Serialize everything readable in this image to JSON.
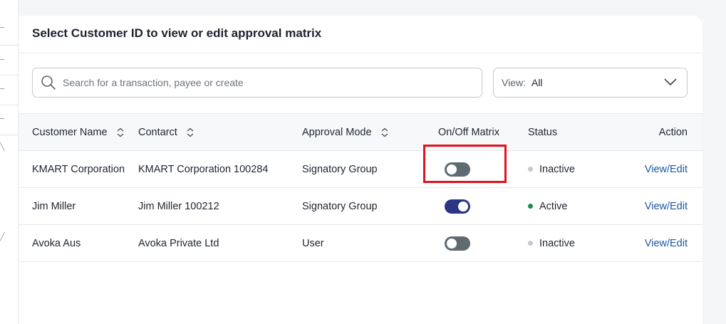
{
  "card": {
    "title": "Select Customer ID to view or edit approval matrix"
  },
  "search": {
    "placeholder": "Search for a transaction, payee or create",
    "icon": "search-icon"
  },
  "view_filter": {
    "label": "View:",
    "value": "All",
    "icon": "chevron-down-icon"
  },
  "table": {
    "headers": {
      "customer_name": "Customer Name",
      "contact": "Contarct",
      "approval_mode": "Approval Mode",
      "matrix": "On/Off Matrix",
      "status": "Status",
      "action": "Action"
    },
    "rows": [
      {
        "customer_name": "KMART Corporation",
        "contact": "KMART Corporation 100284",
        "approval_mode": "Signatory Group",
        "matrix_on": false,
        "status": "Inactive",
        "action": "View/Edit"
      },
      {
        "customer_name": "Jim Miller",
        "contact": "Jim Miller 100212",
        "approval_mode": "Signatory Group",
        "matrix_on": true,
        "status": "Active",
        "action": "View/Edit"
      },
      {
        "customer_name": "Avoka Aus",
        "contact": "Avoka Private Ltd",
        "approval_mode": "User",
        "matrix_on": false,
        "status": "Inactive",
        "action": "View/Edit"
      }
    ]
  },
  "colors": {
    "toggle_on": "#2c3584",
    "toggle_off": "#5f6b71",
    "status_active": "#1f8a4c",
    "status_inactive": "#c4c8ce",
    "link": "#1b56a0",
    "highlight": "#e0121b"
  }
}
